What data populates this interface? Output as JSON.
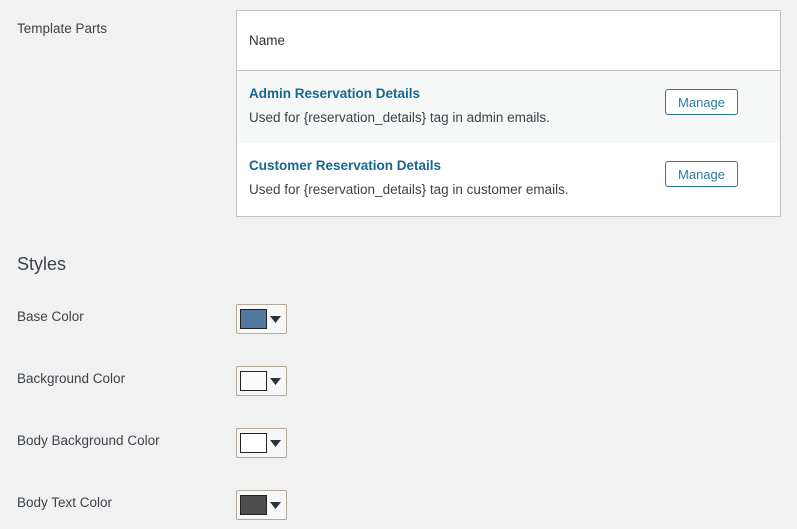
{
  "template_parts": {
    "section_label": "Template Parts",
    "table": {
      "columns": [
        "Name"
      ],
      "rows": [
        {
          "title": "Admin Reservation Details",
          "description": "Used for {reservation_details} tag in admin emails.",
          "action_label": "Manage",
          "striped": true
        },
        {
          "title": "Customer Reservation Details",
          "description": "Used for {reservation_details} tag in customer emails.",
          "action_label": "Manage",
          "striped": false
        }
      ]
    }
  },
  "styles": {
    "heading": "Styles",
    "rows": [
      {
        "label": "Base Color",
        "color": "#55789f",
        "icon": "chevron-down-icon"
      },
      {
        "label": "Background Color",
        "color": "#fcfcfc",
        "icon": "chevron-down-icon"
      },
      {
        "label": "Body Background Color",
        "color": "#ffffff",
        "icon": "chevron-down-icon"
      },
      {
        "label": "Body Text Color",
        "color": "#4e4e4e",
        "icon": "chevron-down-icon"
      }
    ]
  },
  "theme": {
    "page_background": "#f1f1f1",
    "link_color": "#15688f",
    "button_border": "#2b7b9e",
    "table_border": "#c3c4c7",
    "row_stripe": "#f6f7f7"
  }
}
